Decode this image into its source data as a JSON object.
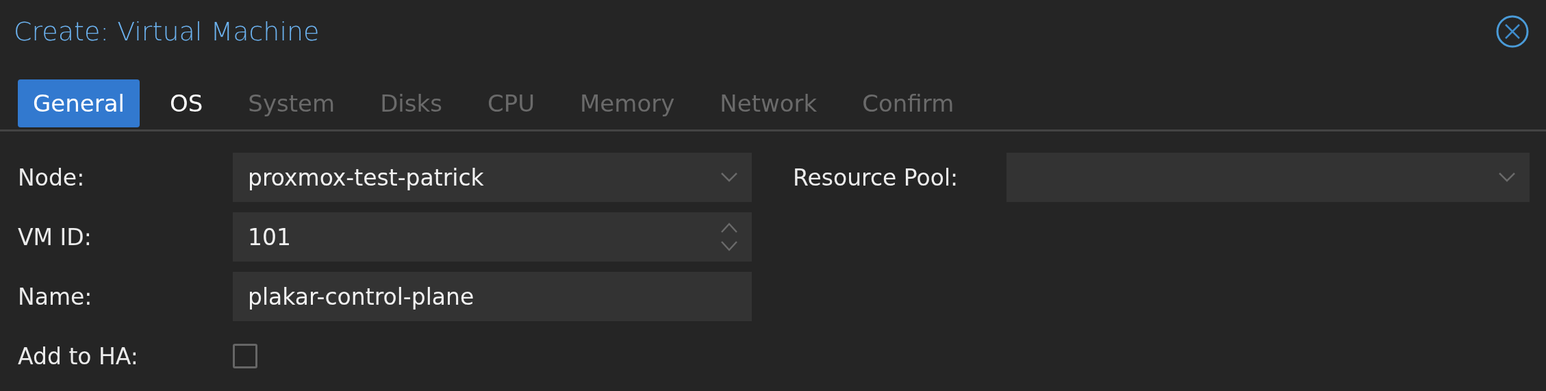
{
  "window": {
    "title": "Create: Virtual Machine"
  },
  "tabs": [
    {
      "label": "General",
      "selected": true,
      "disabled": false
    },
    {
      "label": "OS",
      "selected": false,
      "disabled": false
    },
    {
      "label": "System",
      "selected": false,
      "disabled": true
    },
    {
      "label": "Disks",
      "selected": false,
      "disabled": true
    },
    {
      "label": "CPU",
      "selected": false,
      "disabled": true
    },
    {
      "label": "Memory",
      "selected": false,
      "disabled": true
    },
    {
      "label": "Network",
      "selected": false,
      "disabled": true
    },
    {
      "label": "Confirm",
      "selected": false,
      "disabled": true
    }
  ],
  "left_fields": [
    {
      "label": "Node:",
      "kind": "combo",
      "value": "proxmox-test-patrick"
    },
    {
      "label": "VM ID:",
      "kind": "number",
      "value": "101"
    },
    {
      "label": "Name:",
      "kind": "text",
      "value": "plakar-control-plane"
    },
    {
      "label": "Add to HA:",
      "kind": "checkbox",
      "checked": false
    }
  ],
  "right_fields": [
    {
      "label": "Resource Pool:",
      "kind": "combo"
    }
  ]
}
